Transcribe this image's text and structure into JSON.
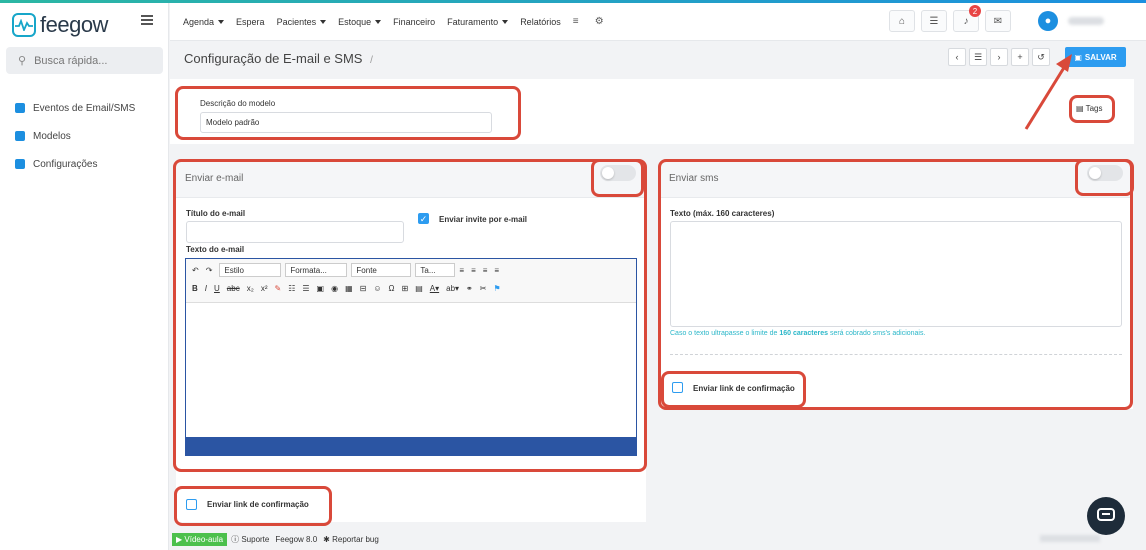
{
  "app": {
    "logo_text": "feegow"
  },
  "sidebar": {
    "search_placeholder": "Busca rápida...",
    "items": [
      {
        "label": "Eventos de Email/SMS"
      },
      {
        "label": "Modelos"
      },
      {
        "label": "Configurações"
      }
    ]
  },
  "topbar": {
    "menu": [
      {
        "label": "Agenda",
        "caret": true
      },
      {
        "label": "Espera",
        "caret": false
      },
      {
        "label": "Pacientes",
        "caret": true
      },
      {
        "label": "Estoque",
        "caret": true
      },
      {
        "label": "Financeiro",
        "caret": false
      },
      {
        "label": "Faturamento",
        "caret": true
      },
      {
        "label": "Relatórios",
        "caret": false
      }
    ],
    "notification_count": "2"
  },
  "page": {
    "title": "Configuração de E-mail e SMS",
    "title_sep": "/",
    "save_label": "SALVAR",
    "tags_label": "Tags"
  },
  "model": {
    "desc_label": "Descrição do modelo",
    "desc_value": "Modelo padrão"
  },
  "email": {
    "header": "Enviar e-mail",
    "title_label": "Título do e-mail",
    "title_value": "",
    "invite_label": "Enviar invite por e-mail",
    "text_label": "Texto do e-mail",
    "editor": {
      "style_select": "Estilo",
      "format_select": "Formata...",
      "font_select": "Fonte",
      "size_select": "Ta..."
    },
    "confirm_label": "Enviar link de confirmação"
  },
  "sms": {
    "header": "Enviar sms",
    "text_label": "Texto (máx. 160 caracteres)",
    "hint_pre": "Caso o texto ultrapasse o limite de ",
    "hint_bold": "160 caracteres",
    "hint_post": " será cobrado sms's adicionais.",
    "confirm_label": "Enviar link de confirmação"
  },
  "footer": {
    "video": "Vídeo-aula",
    "support": "Suporte",
    "version": "Feegow 8.0",
    "bug": "Reportar bug"
  },
  "colors": {
    "accent": "#2d9cf0",
    "highlight": "#d9493a",
    "editor_blue": "#2b55a3"
  }
}
